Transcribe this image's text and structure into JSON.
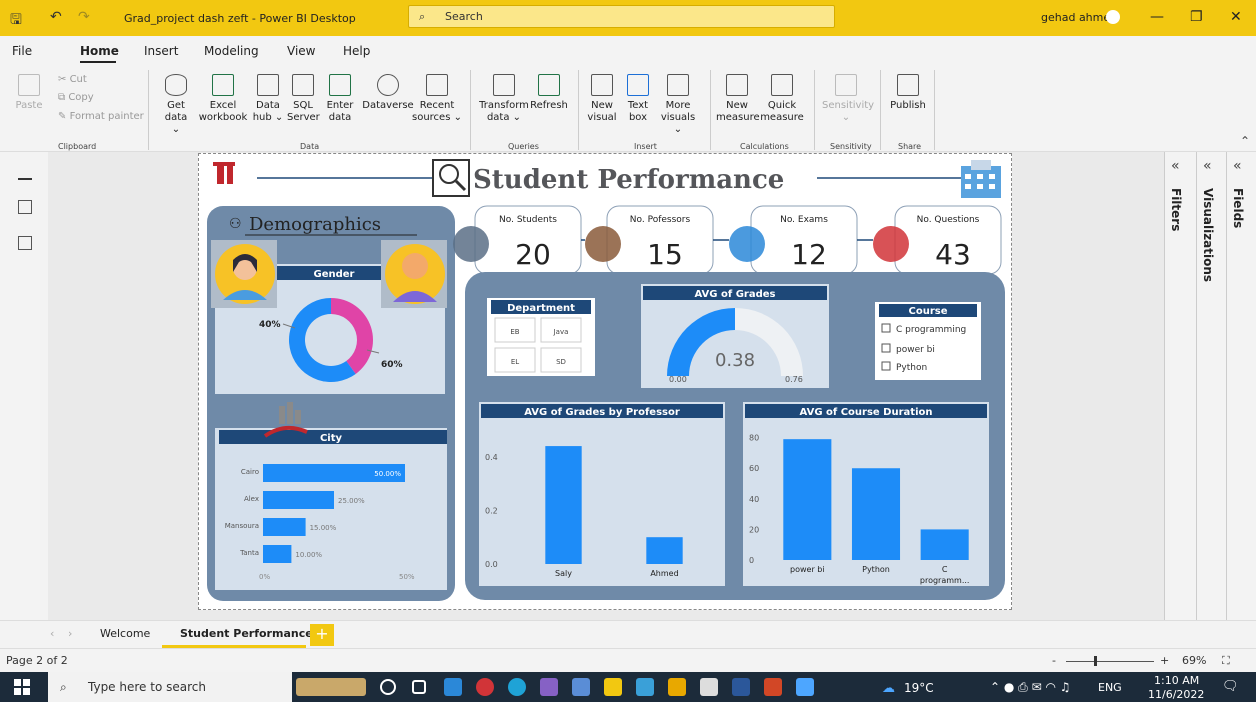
{
  "window": {
    "title": "Grad_project dash zeft - Power BI Desktop",
    "search_placeholder": "Search",
    "user": "gehad ahmed"
  },
  "menu": [
    "File",
    "Home",
    "Insert",
    "Modeling",
    "View",
    "Help"
  ],
  "ribbon": {
    "clipboard": {
      "paste": "Paste",
      "cut": "Cut",
      "copy": "Copy",
      "format_painter": "Format painter",
      "group": "Clipboard"
    },
    "data": {
      "get_data": [
        "Get",
        "data ⌄"
      ],
      "excel": [
        "Excel",
        "workbook"
      ],
      "data_hub": [
        "Data",
        "hub ⌄"
      ],
      "sql": [
        "SQL",
        "Server"
      ],
      "enter_data": [
        "Enter",
        "data"
      ],
      "dataverse": [
        "Dataverse"
      ],
      "recent": [
        "Recent",
        "sources ⌄"
      ],
      "group": "Data"
    },
    "queries": {
      "transform": [
        "Transform",
        "data ⌄"
      ],
      "refresh": [
        "Refresh"
      ],
      "group": "Queries"
    },
    "insert": {
      "new_visual": [
        "New",
        "visual"
      ],
      "text_box": [
        "Text",
        "box"
      ],
      "more_visuals": [
        "More",
        "visuals ⌄"
      ],
      "group": "Insert"
    },
    "calculations": {
      "new_measure": [
        "New",
        "measure"
      ],
      "quick_measure": [
        "Quick",
        "measure"
      ],
      "group": "Calculations"
    },
    "sensitivity": {
      "label": [
        "Sensitivity",
        "⌄"
      ],
      "group": "Sensitivity"
    },
    "share": {
      "publish": [
        "Publish"
      ],
      "group": "Share"
    }
  },
  "panes": {
    "filters": "Filters",
    "visualizations": "Visualizations",
    "fields": "Fields"
  },
  "page_tabs": {
    "welcome": "Welcome",
    "active": "Student Performance",
    "add": "+"
  },
  "status": {
    "page": "Page 2 of 2",
    "zoom": "69%"
  },
  "taskbar": {
    "search": "Type here to search",
    "weather": "19°C",
    "lang": "ENG",
    "time": "1:10 AM",
    "date": "11/6/2022"
  },
  "dashboard": {
    "title": "Student Performance",
    "demographics": "Demographics",
    "kpis": [
      {
        "label": "No. Students",
        "value": "20"
      },
      {
        "label": "No. Pofessors",
        "value": "15"
      },
      {
        "label": "No. Exams",
        "value": "12"
      },
      {
        "label": "No. Questions",
        "value": "43"
      }
    ],
    "gender": {
      "title": "Gender",
      "slices": [
        {
          "label": "40%",
          "value": 40,
          "color": "#e044a7"
        },
        {
          "label": "60%",
          "value": 60,
          "color": "#1d8cf8"
        }
      ]
    },
    "department": {
      "title": "Department",
      "items": [
        "EB",
        "Java",
        "EL",
        "SD"
      ]
    },
    "gauge": {
      "title": "AVG of Grades",
      "value": 0.38,
      "value_label": "0.38",
      "min_label": "0.00",
      "max_label": "0.76",
      "max": 0.76
    },
    "course": {
      "title": "Course",
      "items": [
        "C programming",
        "power bi",
        "Python"
      ]
    },
    "city": {
      "title": "City",
      "items": [
        {
          "name": "Cairo",
          "value": 50,
          "label": "50.00%"
        },
        {
          "name": "Alex",
          "value": 25,
          "label": "25.00%"
        },
        {
          "name": "Mansoura",
          "value": 15,
          "label": "15.00%"
        },
        {
          "name": "Tanta",
          "value": 10,
          "label": "10.00%"
        }
      ],
      "axis": [
        "0%",
        "50%"
      ]
    }
  },
  "chart_data": [
    {
      "type": "bar",
      "title": "AVG of Grades by Professor",
      "categories": [
        "Saly",
        "Ahmed"
      ],
      "values": [
        0.44,
        0.1
      ],
      "ylim": [
        0,
        0.5
      ],
      "yticks": [
        "0.0",
        "0.2",
        "0.4"
      ]
    },
    {
      "type": "bar",
      "title": "AVG of Course Duration",
      "categories": [
        "power bi",
        "Python",
        "C programm..."
      ],
      "values": [
        79,
        60,
        20
      ],
      "ylim": [
        0,
        85
      ],
      "yticks": [
        "0",
        "20",
        "40",
        "60",
        "80"
      ]
    }
  ]
}
